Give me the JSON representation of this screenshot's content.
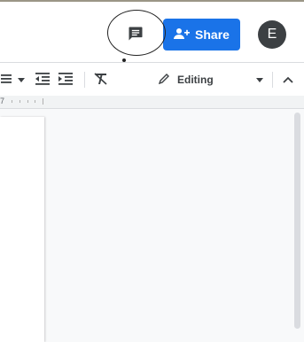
{
  "header": {
    "share_label": "Share",
    "avatar_initial": "E"
  },
  "toolbar": {
    "mode_label": "Editing"
  },
  "ruler": {
    "number": "7"
  },
  "icons": {
    "comment": "comment-icon",
    "share": "person-add-icon",
    "bulleted_list": "bulleted-list-icon",
    "list_dropdown": "chevron-down-icon",
    "decrease_indent": "decrease-indent-icon",
    "increase_indent": "increase-indent-icon",
    "clear_formatting": "clear-formatting-icon",
    "pencil": "pencil-icon",
    "collapse": "chevron-up-icon"
  },
  "colors": {
    "accent": "#1a73e8",
    "avatar_bg": "#3c4043",
    "canvas_bg": "#f8f9fa"
  }
}
